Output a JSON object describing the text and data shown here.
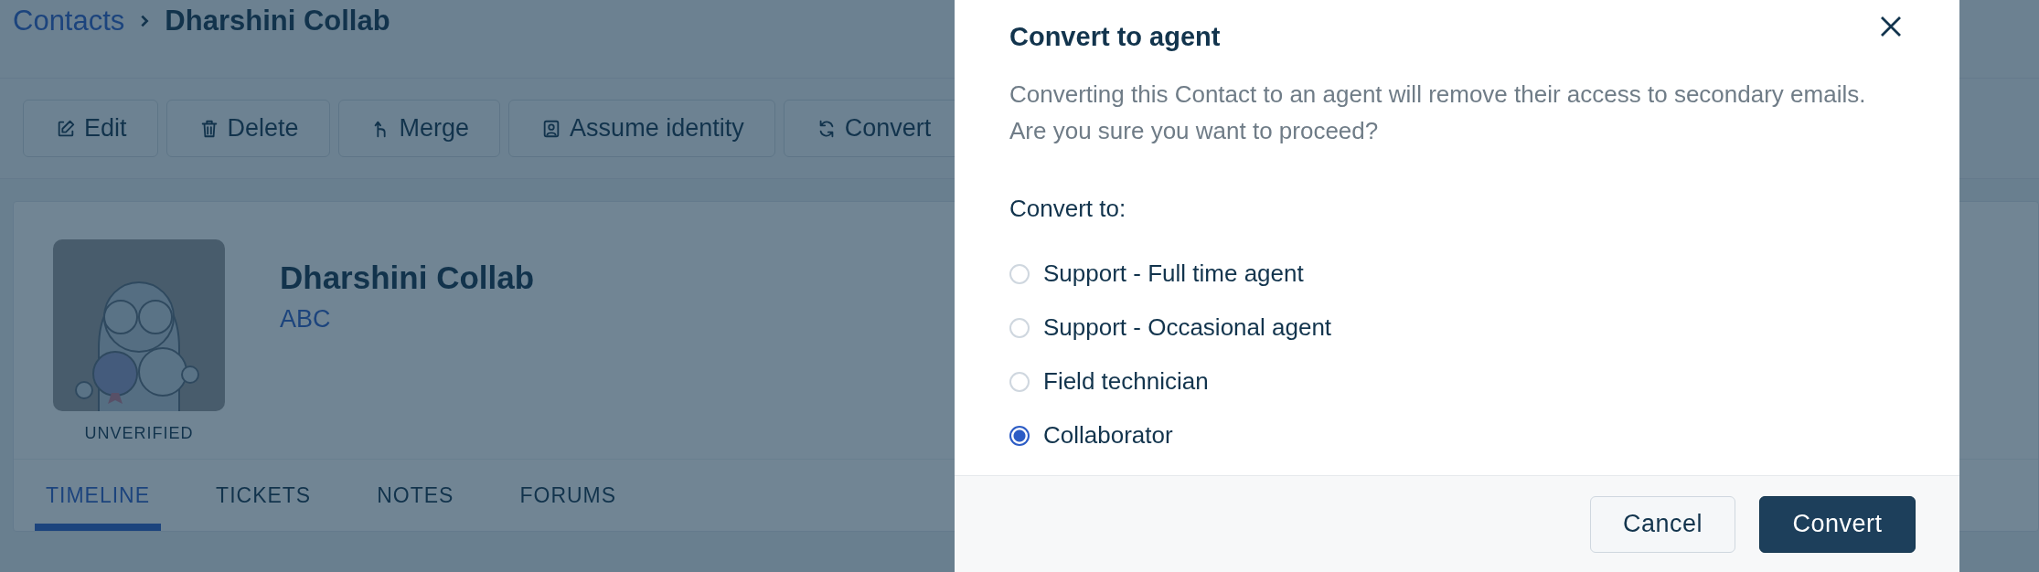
{
  "breadcrumb": {
    "parent": "Contacts",
    "current": "Dharshini Collab"
  },
  "toolbar": [
    {
      "label": "Edit",
      "kind": "edit"
    },
    {
      "label": "Delete",
      "kind": "trash"
    },
    {
      "label": "Merge",
      "kind": "merge"
    },
    {
      "label": "Assume identity",
      "kind": "person"
    },
    {
      "label": "Convert",
      "kind": "convert"
    }
  ],
  "contact": {
    "status": "UNVERIFIED",
    "name": "Dharshini Collab",
    "company": "ABC"
  },
  "tabs": [
    {
      "label": "TIMELINE",
      "selected": true
    },
    {
      "label": "TICKETS",
      "selected": false
    },
    {
      "label": "NOTES",
      "selected": false
    },
    {
      "label": "FORUMS",
      "selected": false
    }
  ],
  "dialog": {
    "title": "Convert to agent",
    "message": "Converting this Contact to an agent will remove their access to secondary emails. Are you sure you want to proceed?",
    "options_label": "Convert to:",
    "options": [
      {
        "label": "Support - Full time agent",
        "selected": false
      },
      {
        "label": "Support - Occasional agent",
        "selected": false
      },
      {
        "label": "Field technician",
        "selected": false
      },
      {
        "label": "Collaborator",
        "selected": true
      }
    ],
    "buttons": [
      {
        "label": "Cancel",
        "kind": "secondary"
      },
      {
        "label": "Convert",
        "kind": "primary"
      }
    ]
  }
}
